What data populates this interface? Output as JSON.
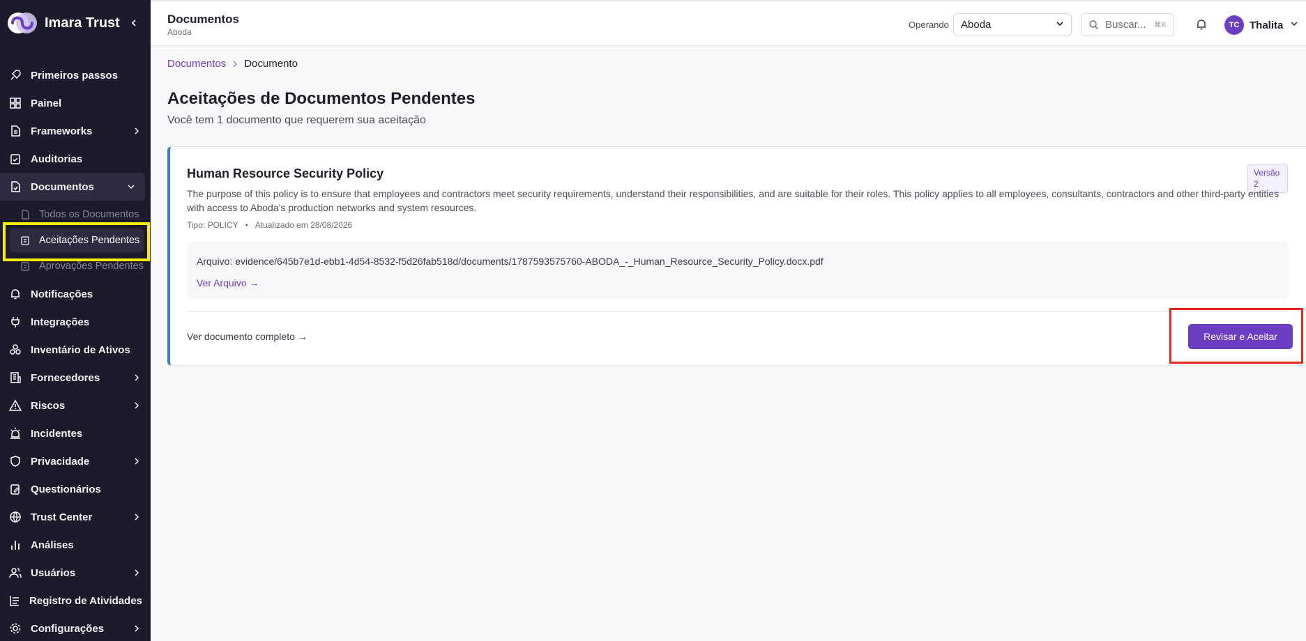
{
  "brand": {
    "name": "Imara Trust"
  },
  "sidebar": {
    "items": [
      {
        "id": "primeiros-passos",
        "label": "Primeiros passos",
        "icon": "rocket-icon",
        "chevron": false
      },
      {
        "id": "painel",
        "label": "Painel",
        "icon": "dashboard-icon",
        "chevron": false
      },
      {
        "id": "frameworks",
        "label": "Frameworks",
        "icon": "file-icon",
        "chevron": true
      },
      {
        "id": "auditorias",
        "label": "Auditorias",
        "icon": "clipboard-check-icon",
        "chevron": false
      },
      {
        "id": "documentos",
        "label": "Documentos",
        "icon": "file-check-icon",
        "chevron": true,
        "expanded": true
      },
      {
        "id": "notificacoes",
        "label": "Notificações",
        "icon": "bell-icon",
        "chevron": false
      },
      {
        "id": "integracoes",
        "label": "Integrações",
        "icon": "plug-icon",
        "chevron": false
      },
      {
        "id": "inventario",
        "label": "Inventário de Ativos",
        "icon": "boxes-icon",
        "chevron": false
      },
      {
        "id": "fornecedores",
        "label": "Fornecedores",
        "icon": "building-icon",
        "chevron": true
      },
      {
        "id": "riscos",
        "label": "Riscos",
        "icon": "warning-icon",
        "chevron": true
      },
      {
        "id": "incidentes",
        "label": "Incidentes",
        "icon": "siren-icon",
        "chevron": false
      },
      {
        "id": "privacidade",
        "label": "Privacidade",
        "icon": "shield-icon",
        "chevron": true
      },
      {
        "id": "questionarios",
        "label": "Questionários",
        "icon": "clipboard-edit-icon",
        "chevron": false
      },
      {
        "id": "trust-center",
        "label": "Trust Center",
        "icon": "globe-icon",
        "chevron": true
      },
      {
        "id": "analises",
        "label": "Análises",
        "icon": "bar-chart-icon",
        "chevron": false
      },
      {
        "id": "usuarios",
        "label": "Usuários",
        "icon": "users-icon",
        "chevron": true
      },
      {
        "id": "registro",
        "label": "Registro de Atividades",
        "icon": "log-icon",
        "chevron": false
      },
      {
        "id": "configuracoes",
        "label": "Configurações",
        "icon": "gear-icon",
        "chevron": true
      }
    ],
    "documentos_sub": [
      {
        "label": "Todos os Documentos",
        "icon": "file-icon"
      },
      {
        "label": "Aceitações Pendentes",
        "icon": "clipboard-icon",
        "current": true
      },
      {
        "label": "Aprovações Pendentes",
        "icon": "clipboard-icon"
      }
    ]
  },
  "header": {
    "title": "Documentos",
    "subtitle": "Aboda",
    "operating_label": "Operando",
    "org_selected": "Aboda",
    "search_placeholder": "Buscar...",
    "search_shortcut": "⌘K",
    "user_initials": "TC",
    "user_name": "Thalita"
  },
  "breadcrumb": {
    "root": "Documentos",
    "current": "Documento"
  },
  "main": {
    "title": "Aceitações de Documentos Pendentes",
    "subtitle": "Você tem 1 documento que requerem sua aceitação"
  },
  "document": {
    "title": "Human Resource Security Policy",
    "description": "The purpose of this policy is to ensure that employees and contractors meet security requirements, understand their responsibilities, and are suitable for their roles. This policy applies to all employees, consultants, contractors and other third-party entities with access to Aboda’s production networks and system resources.",
    "type": "Tipo: POLICY",
    "updated": "Atualizado em 28/08/2026",
    "version_label": "Versão",
    "version_number": "2",
    "file_path": "Arquivo: evidence/645b7e1d-ebb1-4d54-8532-f5d26fab518d/documents/1787593575760-ABODA_-_Human_Resource_Security_Policy.docx.pdf",
    "view_file": "Ver Arquivo →",
    "view_full": "Ver documento completo →",
    "accept_button": "Revisar e Aceitar"
  },
  "colors": {
    "accent": "#6b3ec4",
    "sidebar_bg": "#1d1a2b",
    "card_border": "#3a7bd5"
  }
}
